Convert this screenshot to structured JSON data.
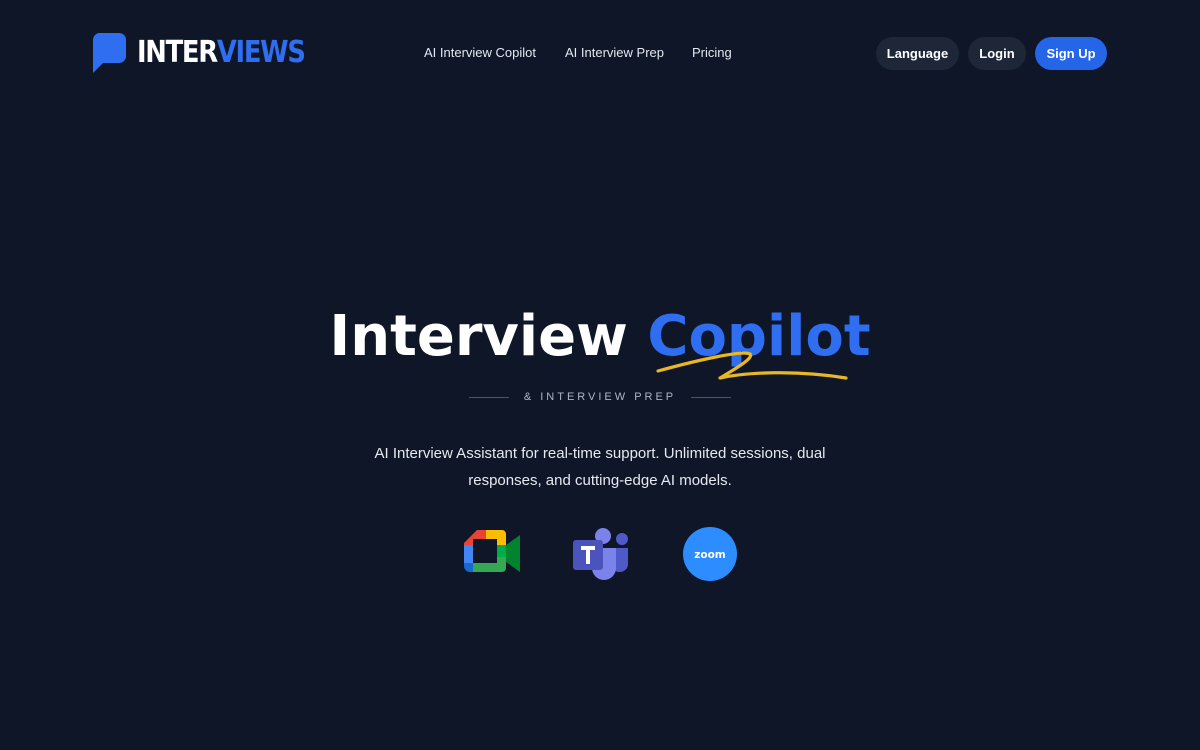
{
  "brand": {
    "name_part1": "INTER",
    "name_part2": "VIEWS",
    "logo_icon": "chat-bubble-icon",
    "accent": "#2f6ef0"
  },
  "nav": {
    "items": [
      {
        "label": "AI Interview Copilot"
      },
      {
        "label": "AI Interview Prep"
      },
      {
        "label": "Pricing"
      }
    ]
  },
  "header_actions": {
    "language_label": "Language",
    "login_label": "Login",
    "signup_label": "Sign Up"
  },
  "hero": {
    "title_part1": "Interview",
    "title_part2": "Copilot",
    "subtitle": "& INTERVIEW PREP",
    "description": "AI Interview Assistant for real-time support. Unlimited sessions, dual responses, and cutting-edge AI models."
  },
  "platforms": [
    {
      "name": "google-meet-icon"
    },
    {
      "name": "microsoft-teams-icon"
    },
    {
      "name": "zoom-icon",
      "label": "zoom"
    }
  ],
  "colors": {
    "background": "#0e1628",
    "primary_button": "#2565e8",
    "secondary_button": "#1e2738",
    "swoosh": "#e8b726"
  }
}
